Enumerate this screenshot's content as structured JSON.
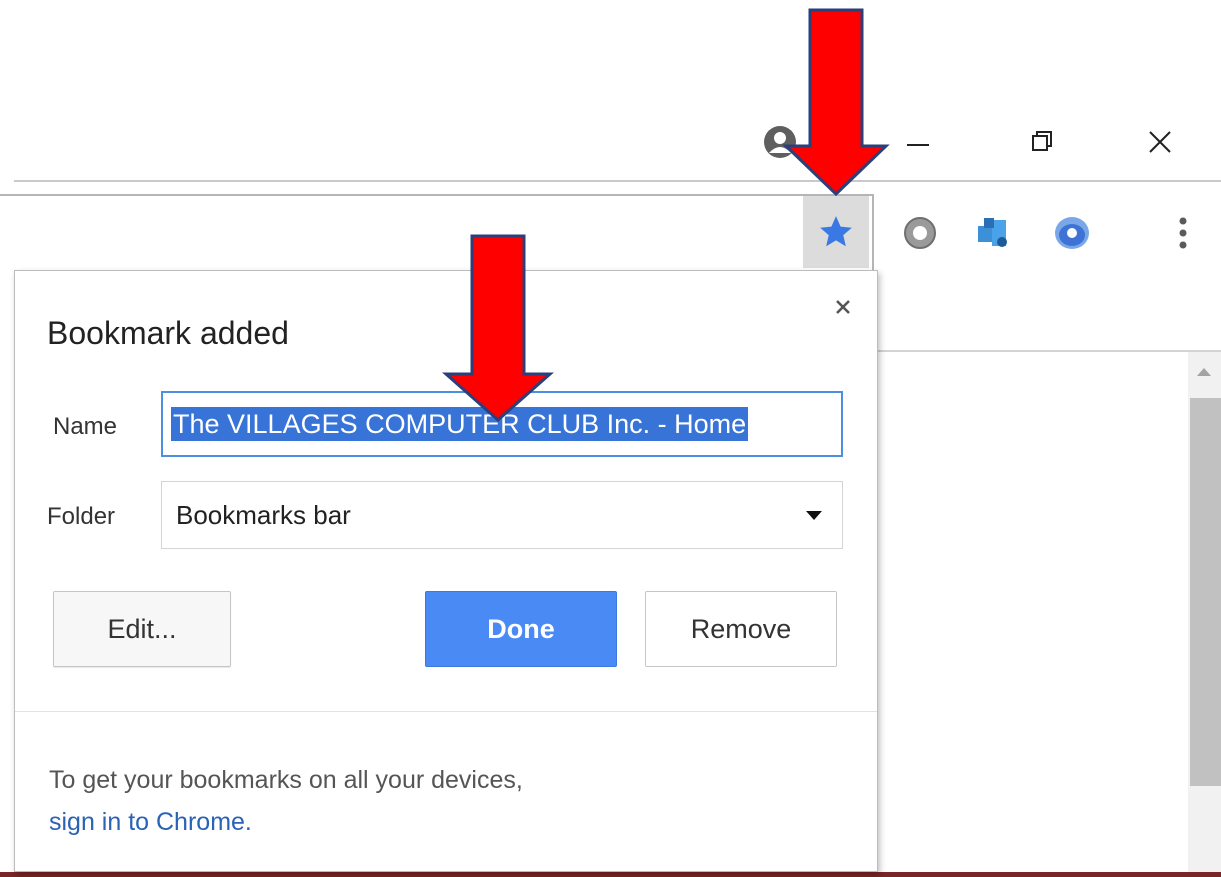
{
  "browser": {
    "window_controls": {
      "profile_icon": "person-circle-icon",
      "minimize_icon": "minimize-icon",
      "restore_icon": "restore-icon",
      "close_icon": "close-icon"
    },
    "toolbar": {
      "bookmark_star_icon": "star-icon",
      "star_color": "#3a78e3",
      "extensions": [
        "gray-ring-extension-icon",
        "puzzle-extension-icon",
        "blue-globe-extension-icon"
      ],
      "menu_icon": "vertical-dots-menu-icon"
    }
  },
  "bookmark_bubble": {
    "title": "Bookmark added",
    "close_icon": "close-icon",
    "name_label": "Name",
    "name_value": "The VILLAGES COMPUTER CLUB Inc. - Home",
    "folder_label": "Folder",
    "folder_value": "Bookmarks bar",
    "edit_button": "Edit...",
    "done_button": "Done",
    "remove_button": "Remove",
    "footer_text": "To get your bookmarks on all your devices,",
    "footer_link": "sign in to Chrome.",
    "accent_color": "#4a8af4"
  },
  "annotations": {
    "arrow_color": "#ff0000",
    "arrow_outline": "#2b3f7a"
  }
}
